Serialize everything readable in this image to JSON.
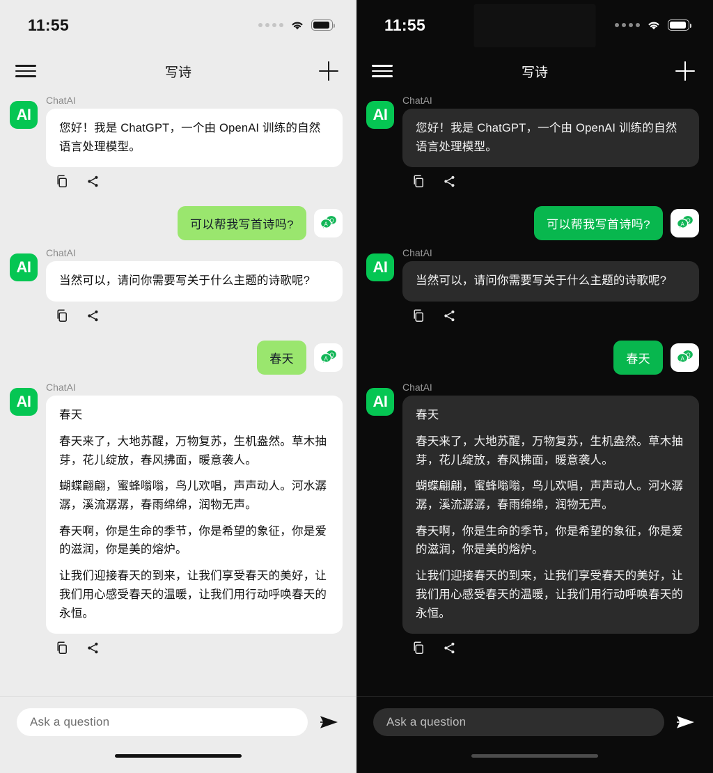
{
  "app": {
    "accent_green_light": "#9ae66e",
    "accent_green_dark": "#08b74e",
    "avatar_green": "#05c653",
    "bg_light": "#ececec",
    "bg_dark": "#0b0b0b",
    "bubble_ai_light": "#ffffff",
    "bubble_ai_dark": "#2b2b2b"
  },
  "statusbar": {
    "time": "11:55",
    "signal_icon": "signal-dots-icon",
    "wifi_icon": "wifi-icon",
    "battery_icon": "battery-icon"
  },
  "navbar": {
    "menu_icon": "hamburger-menu-icon",
    "title": "写诗",
    "new_icon": "plus-icon"
  },
  "avatars": {
    "ai_label": "AI",
    "user_icon": "qa-speech-bubbles-icon",
    "user_bubble_a": "A",
    "user_bubble_q": "Q"
  },
  "messages": [
    {
      "role": "assistant",
      "sender": "ChatAI",
      "text": "您好！我是 ChatGPT，一个由 OpenAI 训练的自然语言处理模型。",
      "actions": [
        "copy-icon",
        "share-icon"
      ]
    },
    {
      "role": "user",
      "text": "可以帮我写首诗吗?"
    },
    {
      "role": "assistant",
      "sender": "ChatAI",
      "text": "当然可以，请问你需要写关于什么主题的诗歌呢?",
      "actions": [
        "copy-icon",
        "share-icon"
      ]
    },
    {
      "role": "user",
      "text": "春天"
    },
    {
      "role": "assistant",
      "sender": "ChatAI",
      "poem": {
        "title": "春天",
        "stanzas": [
          "春天来了，大地苏醒，万物复苏，生机盎然。草木抽芽，花儿绽放，春风拂面，暖意袭人。",
          "蝴蝶翩翩，蜜蜂嗡嗡，鸟儿欢唱，声声动人。河水潺潺，溪流潺潺，春雨绵绵，润物无声。",
          "春天啊，你是生命的季节，你是希望的象征，你是爱的滋润，你是美的熔炉。",
          "让我们迎接春天的到来，让我们享受春天的美好，让我们用心感受春天的温暖，让我们用行动呼唤春天的永恒。"
        ]
      },
      "actions": [
        "copy-icon",
        "share-icon"
      ]
    }
  ],
  "composer": {
    "placeholder": "Ask a question",
    "value": "",
    "send_icon": "send-icon"
  }
}
